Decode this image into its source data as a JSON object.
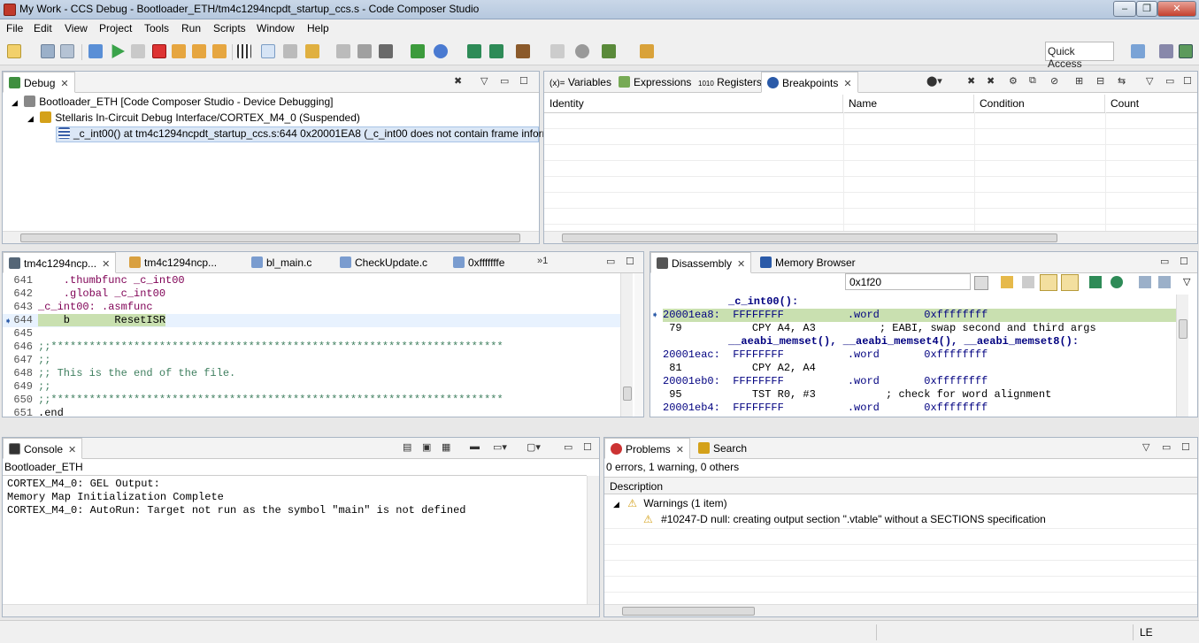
{
  "window": {
    "title": "My Work - CCS Debug - Bootloader_ETH/tm4c1294ncpdt_startup_ccs.s - Code Composer Studio"
  },
  "menu": [
    "File",
    "Edit",
    "View",
    "Project",
    "Tools",
    "Run",
    "Scripts",
    "Window",
    "Help"
  ],
  "toolbar": {
    "quick_access": "Quick Access"
  },
  "debug": {
    "tab": "Debug",
    "rows": [
      "Bootloader_ETH [Code Composer Studio - Device Debugging]",
      "Stellaris In-Circuit Debug Interface/CORTEX_M4_0 (Suspended)",
      "_c_int00() at tm4c1294ncpdt_startup_ccs.s:644 0x20001EA8  (_c_int00 does not contain frame inform"
    ]
  },
  "vars": {
    "tabs": [
      "Variables",
      "Expressions",
      "Registers",
      "Breakpoints"
    ],
    "cols": [
      "Identity",
      "Name",
      "Condition",
      "Count"
    ]
  },
  "editor": {
    "tabs": [
      "tm4c1294ncp...",
      "tm4c1294ncp...",
      "bl_main.c",
      "CheckUpdate.c",
      "0xfffffffe"
    ],
    "overflow": "»1",
    "lines": [
      {
        "n": "641",
        "t": "    .thumbfunc _c_int00"
      },
      {
        "n": "642",
        "t": "    .global _c_int00"
      },
      {
        "n": "643",
        "t": "_c_int00: .asmfunc"
      },
      {
        "n": "644",
        "t": "    b       ResetISR"
      },
      {
        "n": "645",
        "t": ""
      },
      {
        "n": "646",
        "t": ";;***********************************************************************"
      },
      {
        "n": "647",
        "t": ";;"
      },
      {
        "n": "648",
        "t": ";; This is the end of the file."
      },
      {
        "n": "649",
        "t": ";;"
      },
      {
        "n": "650",
        "t": ";;***********************************************************************"
      },
      {
        "n": "651",
        "t": ".end"
      }
    ]
  },
  "disasm": {
    "tabs": [
      "Disassembly",
      "Memory Browser"
    ],
    "address_input": "0x1f20",
    "lines": [
      {
        "t": "_c_int00():",
        "k": "fn"
      },
      {
        "t": "20001ea8:  FFFFFFFF          .word       0xffffffff",
        "k": "cur"
      },
      {
        "t": " 79           CPY A4, A3          ; EABI, swap second and third args",
        "k": "src"
      },
      {
        "t": "__aeabi_memset(), __aeabi_memset4(), __aeabi_memset8():",
        "k": "fn"
      },
      {
        "t": "20001eac:  FFFFFFFF          .word       0xffffffff",
        "k": "asm"
      },
      {
        "t": " 81           CPY A2, A4",
        "k": "src"
      },
      {
        "t": "20001eb0:  FFFFFFFF          .word       0xffffffff",
        "k": "asm"
      },
      {
        "t": " 95           TST R0, #3           ; check for word alignment",
        "k": "src"
      },
      {
        "t": "20001eb4:  FFFFFFFF          .word       0xffffffff",
        "k": "asm"
      }
    ]
  },
  "console": {
    "tab": "Console",
    "title": "Bootloader_ETH",
    "lines": [
      "CORTEX_M4_0: GEL Output:",
      "Memory Map Initialization Complete",
      "CORTEX_M4_0: AutoRun: Target not run as the symbol \"main\" is not defined"
    ]
  },
  "problems": {
    "tabs": [
      "Problems",
      "Search"
    ],
    "summary": "0 errors, 1 warning, 0 others",
    "col": "Description",
    "group": "Warnings (1 item)",
    "item": "#10247-D null: creating output section \".vtable\" without a SECTIONS specification"
  },
  "status": {
    "mode": "LE"
  },
  "colors": {
    "highlight": "#c9e0b0",
    "accent": "#3366cc"
  }
}
